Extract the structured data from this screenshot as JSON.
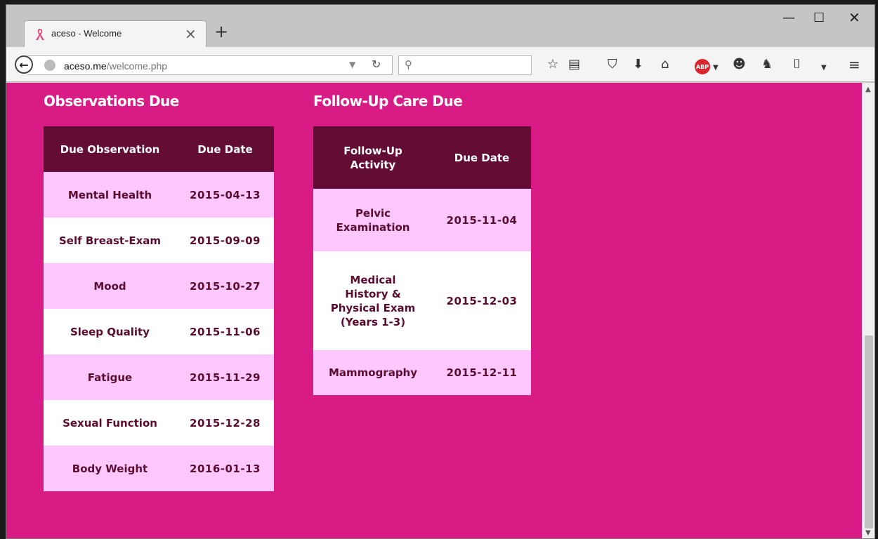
{
  "browser": {
    "tab_title": "aceso - Welcome",
    "tab_close": "×",
    "new_tab": "+",
    "url_host": "aceso.me",
    "url_path": "/welcome.php",
    "window_controls": {
      "minimize": "—",
      "maximize": "☐",
      "close": "✕"
    }
  },
  "page": {
    "observations": {
      "heading": "Observations Due",
      "headers": [
        "Due Observation",
        "Due Date"
      ],
      "rows": [
        {
          "name": "Mental Health",
          "date": "2015-04-13"
        },
        {
          "name": "Self Breast-Exam",
          "date": "2015-09-09"
        },
        {
          "name": "Mood",
          "date": "2015-10-27"
        },
        {
          "name": "Sleep Quality",
          "date": "2015-11-06"
        },
        {
          "name": "Fatigue",
          "date": "2015-11-29"
        },
        {
          "name": "Sexual Function",
          "date": "2015-12-28"
        },
        {
          "name": "Body Weight",
          "date": "2016-01-13"
        }
      ]
    },
    "followup": {
      "heading": "Follow-Up Care Due",
      "headers": [
        "Follow-Up Activity",
        "Due Date"
      ],
      "rows": [
        {
          "name": "Pelvic Examination",
          "date": "2015-11-04"
        },
        {
          "name": "Medical History & Physical Exam (Years 1-3)",
          "date": "2015-12-03"
        },
        {
          "name": "Mammography",
          "date": "2015-12-11"
        }
      ]
    }
  },
  "colors": {
    "page_bg": "#d81b85",
    "header_bg": "#630c34",
    "row_alt": "#fec8fe",
    "row_text": "#5a0c2f"
  }
}
